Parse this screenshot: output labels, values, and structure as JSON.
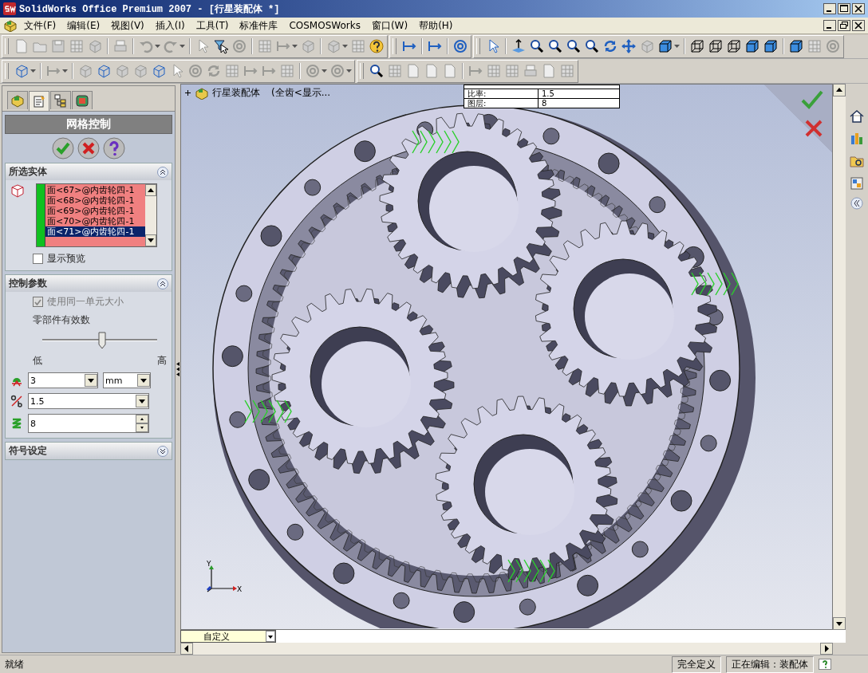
{
  "window": {
    "title": "SolidWorks Office Premium 2007 - [行星装配体 *]"
  },
  "menu": [
    "文件(F)",
    "编辑(E)",
    "视图(V)",
    "插入(I)",
    "工具(T)",
    "标准件库",
    "COSMOSWorks",
    "窗口(W)",
    "帮助(H)"
  ],
  "property_manager": {
    "tabs": [
      {
        "selected": false
      },
      {
        "selected": true
      },
      {
        "selected": false
      },
      {
        "selected": false
      }
    ],
    "title": "网格控制",
    "selected_entities": {
      "title": "所选实体",
      "expanded": true,
      "items": [
        {
          "label": "面<67>@内齿轮四-1",
          "selected": false
        },
        {
          "label": "面<68>@内齿轮四-1",
          "selected": false
        },
        {
          "label": "面<69>@内齿轮四-1",
          "selected": false
        },
        {
          "label": "面<70>@内齿轮四-1",
          "selected": false
        },
        {
          "label": "面<71>@内齿轮四-1",
          "selected": true
        }
      ],
      "show_preview": {
        "label": "显示预览",
        "checked": false
      }
    },
    "control_parameters": {
      "title": "控制参数",
      "expanded": true,
      "same_element_size": {
        "label": "使用同一单元大小",
        "checked": true,
        "disabled": true
      },
      "slider_label": "零部件有效数",
      "slider": {
        "level": 0.52
      },
      "low": "低",
      "high": "高",
      "element_size": {
        "value": "3",
        "unit": "mm"
      },
      "ratio": {
        "value": "1.5"
      },
      "layers": {
        "value": "8"
      }
    },
    "symbol_settings": {
      "title": "符号设定",
      "expanded": false
    }
  },
  "viewport": {
    "tree_label": "行星装配体",
    "tree_note": "(全齿<显示...",
    "info_table": [
      {
        "label": "比率:",
        "value": "1.5"
      },
      {
        "label": "图层:",
        "value": "8"
      }
    ],
    "axis_labels": [
      "X",
      "Y"
    ],
    "view_orientation": "自定义"
  },
  "status_bar": [
    "就绪",
    "完全定义",
    "正在编辑：装配体"
  ]
}
